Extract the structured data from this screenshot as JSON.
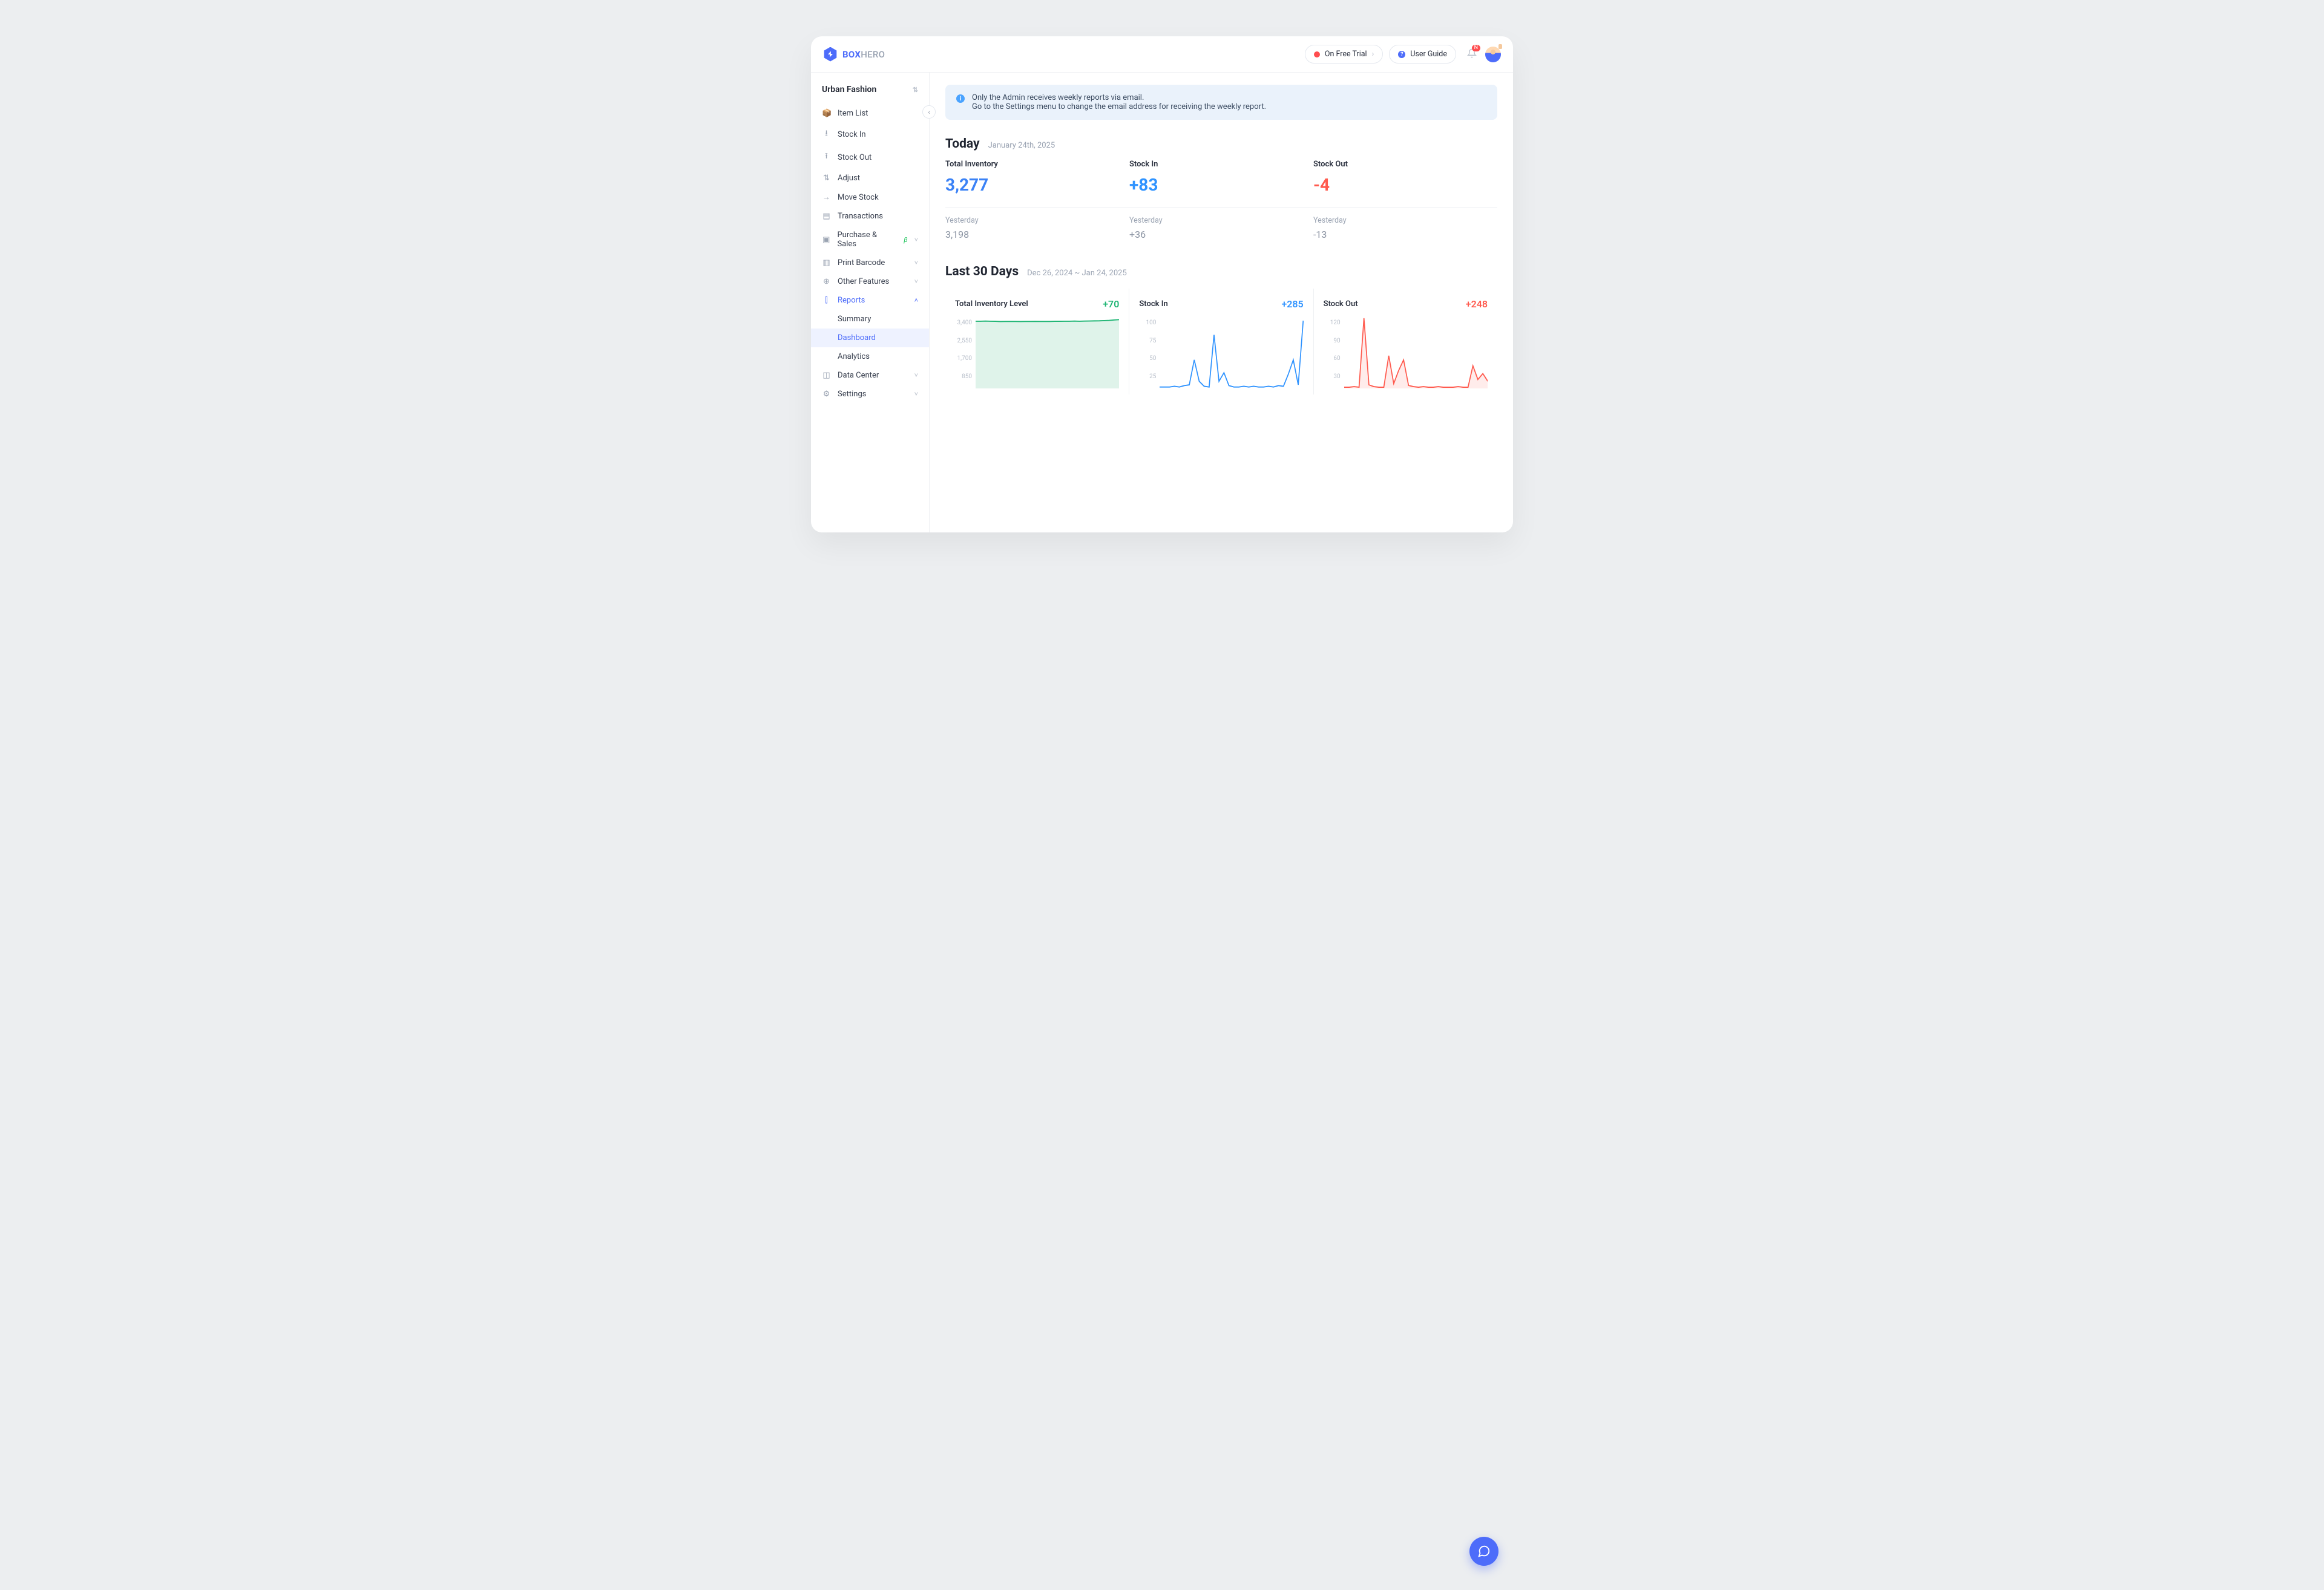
{
  "brand": {
    "part1": "BOX",
    "part2": "HERO"
  },
  "header": {
    "trial_label": "On Free Trial",
    "guide_label": "User Guide",
    "notification_badge": "N"
  },
  "workspace": {
    "name": "Urban Fashion"
  },
  "sidebar": {
    "items": [
      {
        "icon": "📦",
        "label": "Item List"
      },
      {
        "icon": "⭳",
        "label": "Stock In"
      },
      {
        "icon": "⭱",
        "label": "Stock Out"
      },
      {
        "icon": "⇅",
        "label": "Adjust"
      },
      {
        "icon": "→",
        "label": "Move Stock"
      },
      {
        "icon": "▤",
        "label": "Transactions"
      },
      {
        "icon": "▣",
        "label": "Purchase & Sales",
        "beta": "β",
        "expand": true
      },
      {
        "icon": "▥",
        "label": "Print Barcode",
        "expand": true
      },
      {
        "icon": "⊕",
        "label": "Other Features",
        "expand": true
      },
      {
        "icon": "⫿",
        "label": "Reports",
        "expand": true,
        "active": true,
        "open": true
      },
      {
        "icon": "◫",
        "label": "Data Center",
        "expand": true
      },
      {
        "icon": "⚙",
        "label": "Settings",
        "expand": true
      }
    ],
    "reports_sub": [
      {
        "label": "Summary"
      },
      {
        "label": "Dashboard",
        "active": true
      },
      {
        "label": "Analytics"
      }
    ]
  },
  "banner": {
    "line1": "Only the Admin receives weekly reports via email.",
    "line2": "Go to the Settings menu to change the email address for receiving the weekly report."
  },
  "today": {
    "title": "Today",
    "date": "January 24th, 2025",
    "stats": [
      {
        "label": "Total Inventory",
        "value": "3,277",
        "cls": "c-blue"
      },
      {
        "label": "Stock In",
        "value": "+83",
        "cls": "c-cyan"
      },
      {
        "label": "Stock Out",
        "value": "-4",
        "cls": "c-red"
      }
    ],
    "yesterday_label": "Yesterday",
    "yesterday": [
      "3,198",
      "+36",
      "-13"
    ]
  },
  "last30": {
    "title": "Last 30 Days",
    "range": "Dec 26, 2024 ~ Jan 24, 2025",
    "cards": [
      {
        "title": "Total Inventory Level",
        "delta": "+70",
        "cls": "c-green"
      },
      {
        "title": "Stock In",
        "delta": "+285",
        "cls": "c-cyan"
      },
      {
        "title": "Stock Out",
        "delta": "+248",
        "cls": "c-red"
      }
    ]
  },
  "chart_data": [
    {
      "type": "area",
      "title": "Total Inventory Level",
      "y_ticks": [
        3400,
        2550,
        1700,
        850
      ],
      "ylim": [
        0,
        3400
      ],
      "color": "#1fb574",
      "fill": "#dff3ea",
      "values": [
        3198,
        3200,
        3205,
        3200,
        3195,
        3185,
        3190,
        3190,
        3188,
        3185,
        3190,
        3190,
        3192,
        3190,
        3188,
        3190,
        3195,
        3195,
        3200,
        3200,
        3205,
        3200,
        3205,
        3210,
        3215,
        3220,
        3230,
        3240,
        3260,
        3277
      ]
    },
    {
      "type": "line",
      "title": "Stock In",
      "y_ticks": [
        100,
        75,
        50,
        25
      ],
      "ylim": [
        0,
        100
      ],
      "color": "#2f93ff",
      "fill": "none",
      "values": [
        2,
        2,
        2,
        3,
        2,
        4,
        5,
        40,
        10,
        3,
        2,
        75,
        10,
        22,
        4,
        2,
        2,
        3,
        2,
        3,
        2,
        2,
        3,
        2,
        4,
        3,
        20,
        40,
        5,
        95
      ]
    },
    {
      "type": "line",
      "title": "Stock Out",
      "y_ticks": [
        120,
        90,
        60,
        30
      ],
      "ylim": [
        0,
        120
      ],
      "color": "#ff5a4e",
      "fill": "#ffeceb",
      "values": [
        2,
        2,
        3,
        2,
        118,
        6,
        3,
        2,
        2,
        55,
        8,
        30,
        48,
        5,
        3,
        2,
        3,
        2,
        2,
        3,
        2,
        2,
        2,
        3,
        2,
        2,
        38,
        15,
        25,
        12
      ]
    }
  ]
}
